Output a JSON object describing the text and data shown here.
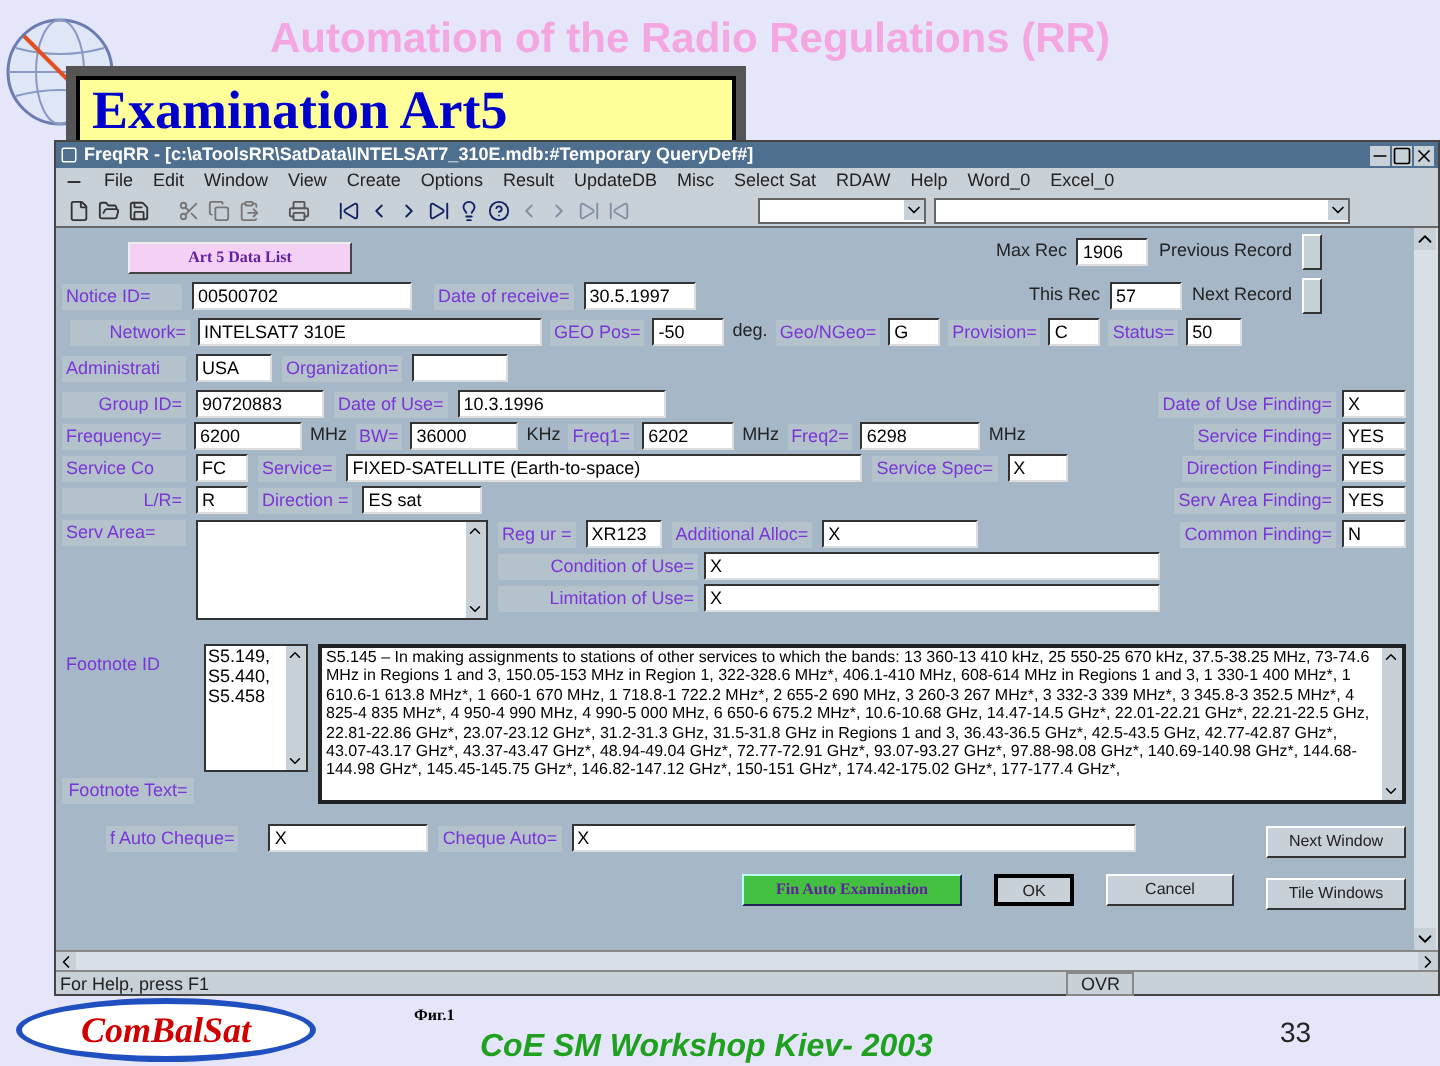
{
  "slide": {
    "title": "Automation of the Radio Regulations (RR)",
    "heading": "Examination Art5",
    "logo_text": "ComBalSat",
    "caption": "Фиг.1",
    "footer": "CoE SM Workshop Kiev- 2003",
    "page": "33"
  },
  "window": {
    "title": "FreqRR - [c:\\aToolsRR\\SatData\\INTELSAT7_310E.mdb:#Temporary QueryDef#]"
  },
  "menu": [
    "File",
    "Edit",
    "Window",
    "View",
    "Create",
    "Options",
    "Result",
    "UpdateDB",
    "Misc",
    "Select Sat",
    "RDAW",
    "Help",
    "Word_0",
    "Excel_0"
  ],
  "form": {
    "list_button": "Art 5 Data List",
    "max_rec": {
      "label": "Max Rec",
      "value": "1906"
    },
    "this_rec": {
      "label": "This Rec",
      "value": "57"
    },
    "previous_record": "Previous Record",
    "next_record": "Next Record",
    "notice_id": {
      "label": "Notice ID=",
      "value": "00500702"
    },
    "date_of_receive": {
      "label": "Date of receive=",
      "value": "30.5.1997"
    },
    "network": {
      "label": "Network=",
      "value": "INTELSAT7 310E"
    },
    "geo_pos": {
      "label": "GEO Pos=",
      "value": "-50",
      "unit": "deg."
    },
    "geo_ngeo": {
      "label": "Geo/NGeo=",
      "value": "G"
    },
    "provision": {
      "label": "Provision=",
      "value": "C"
    },
    "status": {
      "label": "Status=",
      "value": "50"
    },
    "administration": {
      "label": "Administrati",
      "value": "USA"
    },
    "organization": {
      "label": "Organization="
    },
    "group_id": {
      "label": "Group ID=",
      "value": "90720883"
    },
    "date_of_use": {
      "label": "Date of Use=",
      "value": "10.3.1996"
    },
    "frequency": {
      "label": "Frequency=",
      "value": "6200",
      "unit": "MHz"
    },
    "bw": {
      "label": "BW=",
      "value": "36000",
      "unit": "KHz"
    },
    "freq1": {
      "label": "Freq1=",
      "value": "6202",
      "unit": "MHz"
    },
    "freq2": {
      "label": "Freq2=",
      "value": "6298",
      "unit": "MHz"
    },
    "service_code": {
      "label": "Service Co",
      "value": "FC"
    },
    "service": {
      "label": "Service=",
      "value": "FIXED-SATELLITE (Earth-to-space)"
    },
    "service_spec": {
      "label": "Service Spec=",
      "value": "X"
    },
    "lr": {
      "label": "L/R=",
      "value": "R"
    },
    "direction": {
      "label": "Direction =",
      "value": "ES sat"
    },
    "serv_area": {
      "label": "Serv Area="
    },
    "reg_ur": {
      "label": "Reg ur =",
      "value": "XR123"
    },
    "additional_alloc": {
      "label": "Additional Alloc=",
      "value": "X"
    },
    "condition_of_use": {
      "label": "Condition of Use=",
      "value": "X"
    },
    "limitation_of_use": {
      "label": "Limitation of Use=",
      "value": "X"
    },
    "findings": [
      {
        "label": "Date of Use Finding=",
        "value": "X"
      },
      {
        "label": "Service Finding=",
        "value": "YES"
      },
      {
        "label": "Direction Finding=",
        "value": "YES"
      },
      {
        "label": "Serv Area Finding=",
        "value": "YES"
      },
      {
        "label": "Common Finding=",
        "value": "N"
      }
    ],
    "footnote_id": {
      "label": "Footnote ID",
      "items": [
        "S5.149,",
        "S5.440,",
        "S5.458"
      ]
    },
    "footnote_text": {
      "label": "Footnote Text=",
      "value": "S5.145 – In making assignments to stations of other services to which the bands: 13 360-13 410 kHz, 25 550-25 670 kHz, 37.5-38.25 MHz, 73-74.6 MHz in Regions 1 and 3, 150.05-153 MHz in Region 1, 322-328.6 MHz*, 406.1-410 MHz, 608-614 MHz in Regions 1 and 3, 1 330-1 400 MHz*, 1 610.6-1 613.8 MHz*, 1 660-1 670 MHz, 1 718.8-1 722.2 MHz*, 2 655-2 690 MHz, 3 260-3 267 MHz*, 3 332-3 339 MHz*, 3 345.8-3 352.5 MHz*, 4 825-4 835 MHz*, 4 950-4 990 MHz, 4 990-5 000 MHz, 6 650-6 675.2 MHz*, 10.6-10.68 GHz, 14.47-14.5 GHz*, 22.01-22.21 GHz*, 22.21-22.5 GHz, 22.81-22.86 GHz*, 23.07-23.12 GHz*, 31.2-31.3 GHz, 31.5-31.8 GHz in Regions 1 and 3, 36.43-36.5 GHz*, 42.5-43.5 GHz, 42.77-42.87 GHz*, 43.07-43.17 GHz*, 43.37-43.47 GHz*, 48.94-49.04 GHz*, 72.77-72.91 GHz*, 93.07-93.27 GHz*, 97.88-98.08 GHz*, 140.69-140.98 GHz*, 144.68-144.98 GHz*, 145.45-145.75 GHz*, 146.82-147.12 GHz*, 150-151 GHz*, 174.42-175.02 GHz*, 177-177.4 GHz*,"
    },
    "f_auto_cheque": {
      "label": "f Auto Cheque=",
      "value": "X"
    },
    "cheque_auto": {
      "label": "Cheque Auto=",
      "value": "X"
    },
    "buttons": [
      {
        "label": "Next Window",
        "kind": "side"
      },
      {
        "label": "Fin Auto Examination",
        "kind": "green"
      },
      {
        "label": "OK",
        "kind": "default"
      },
      {
        "label": "Cancel",
        "kind": "plain"
      },
      {
        "label": "Tile Windows",
        "kind": "side"
      }
    ]
  },
  "status_bar": {
    "text": "For Help, press F1",
    "mode": "OVR"
  }
}
